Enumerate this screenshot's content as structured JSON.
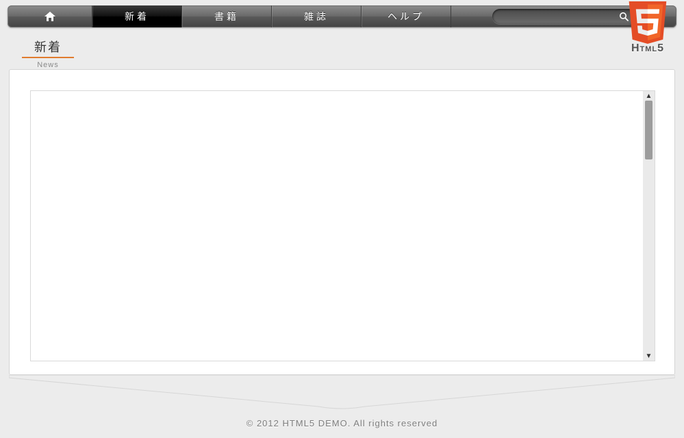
{
  "nav": {
    "items": [
      {
        "label": "新着"
      },
      {
        "label": "書籍"
      },
      {
        "label": "雑誌"
      },
      {
        "label": "ヘルプ"
      }
    ]
  },
  "search": {
    "value": ""
  },
  "logo": {
    "text": "Html5"
  },
  "page": {
    "title_jp": "新着",
    "title_en": "News"
  },
  "footer": {
    "text": "© 2012 HTML5 DEMO. All rights reserved"
  }
}
